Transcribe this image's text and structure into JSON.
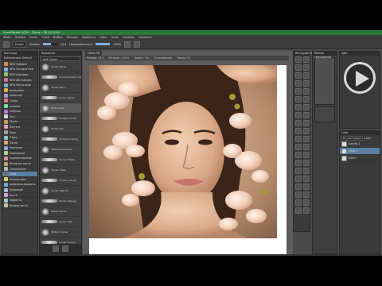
{
  "window": {
    "title": "CorelPainter 2020 - Olena • 30.10.2019"
  },
  "menu": [
    "Файл",
    "Правка",
    "Холст",
    "Слой",
    "Выбор",
    "Фигуры",
    "Эффекты",
    "Перо",
    "Окно",
    "Справка",
    "Рисовать"
  ],
  "toolbar": {
    "brush_label": "Eraser",
    "size_label": "Размер",
    "size_value": "29.5",
    "opacity_label": "Непрозрачность",
    "opacity_value": "100%",
    "opacity_level": 1.0,
    "size_level": 0.55
  },
  "left_panel": {
    "header": "Кисточки",
    "selector": "Библиотека: Default",
    "categories": [
      {
        "label": "NEW Эмбиент",
        "color": "#d38a5a"
      },
      {
        "label": "NEW Распылители",
        "color": "#8ab0d8"
      },
      {
        "label": "NEW Шиппиро",
        "color": "#9ac07a"
      },
      {
        "label": "NEW Абстракция",
        "color": "#c07a9a"
      },
      {
        "label": "NEW Кисти вода",
        "color": "#7ab0c8"
      },
      {
        "label": "Акриловые",
        "color": "#d8b05a"
      },
      {
        "label": "Аэрограф",
        "color": "#9a9ad8"
      },
      {
        "label": "Гуашь",
        "color": "#d87a7a"
      },
      {
        "label": "Заливка",
        "color": "#7ad8a0"
      },
      {
        "label": "Клонеры",
        "color": "#b07ad8"
      },
      {
        "label": "Мел",
        "color": "#d8d8d8"
      },
      {
        "label": "Масло",
        "color": "#c09a60"
      },
      {
        "label": "Пастель",
        "color": "#e0a0c0"
      },
      {
        "label": "Перо",
        "color": "#a0a0a0"
      },
      {
        "label": "Перья",
        "color": "#8fc0c0"
      },
      {
        "label": "Пятна",
        "color": "#d0b080"
      },
      {
        "label": "Размытие",
        "color": "#90a0d0"
      },
      {
        "label": "Карандаши",
        "color": "#b0d090"
      },
      {
        "label": "Художественное",
        "color": "#d090a0"
      },
      {
        "label": "Реальные масла",
        "color": "#c0a070"
      },
      {
        "label": "Смешивание",
        "color": "#a0c0a0"
      },
      {
        "label": "Тушь",
        "color": "#707070"
      },
      {
        "label": "Фломастеры",
        "color": "#d0d070"
      },
      {
        "label": "Цифровая акварель",
        "color": "#70b0d0"
      },
      {
        "label": "Цифровые",
        "color": "#b0b0d0"
      },
      {
        "label": "Кисти",
        "color": "#d0a0d0"
      },
      {
        "label": "Эффекты",
        "color": "#a0d0d0"
      },
      {
        "label": "Мелкие кисти",
        "color": "#d0c0a0"
      }
    ],
    "selected_index": 21
  },
  "brush_panel": {
    "header": "Варианты",
    "selected": "Soft Cloner",
    "variants": [
      "Cloner Spray",
      "Camel Impasto Cloner",
      "Cloner Pencil",
      "Cloner Pastel",
      "Soft Cloner",
      "Straight Cloner",
      "Cloner Pen",
      "Oil Brush Cloner",
      "Watercolor Cloner",
      "Cloner Bristle",
      "Cloner Chalk",
      "Smeary Cloner",
      "Cloner Blender",
      "Cloner Sponge",
      "Detail Cloner",
      "Cloner Dab",
      "Pattern Cloner",
      "Cloner Grainy"
    ],
    "selected_index": 4
  },
  "document": {
    "tab": "Olena.riff",
    "props": [
      "Размер: 29.5",
      "Непрозр.: 100%",
      "Захват: 0%",
      "Сглаживание",
      "Зерно: 0%"
    ]
  },
  "right": {
    "tools_header": "Инструменты",
    "color_header": "Цвет",
    "mixer_header": "Панель смешивания",
    "layers_header": "Слои",
    "layers": [
      {
        "label": "Canvas 1",
        "selected": false
      },
      {
        "label": "Слой 1",
        "selected": true
      },
      {
        "label": "Холст",
        "selected": false
      }
    ],
    "blend_mode": "По умолчанию",
    "layer_opacity": "100%"
  },
  "overlay": {
    "icon": "play-icon"
  }
}
